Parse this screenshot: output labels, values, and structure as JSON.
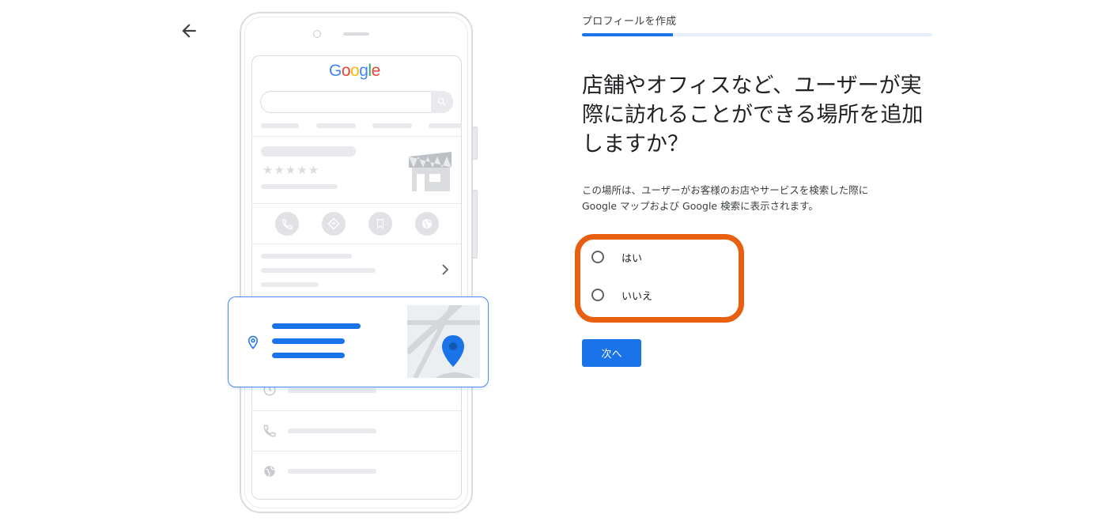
{
  "header": {
    "step_label": "プロフィールを作成",
    "progress": 0.26
  },
  "nav": {
    "back_icon": "arrow-back-icon"
  },
  "question": {
    "title": "店舗やオフィスなど、ユーザーが実際に訪れることができる場所を追加しますか？",
    "description_line1": "この場所は、ユーザーがお客様のお店やサービスを検索した際に",
    "description_line2": "Google マップおよび Google 検索に表示されます。"
  },
  "options": [
    {
      "label": "はい",
      "selected": false
    },
    {
      "label": "いいえ",
      "selected": false
    }
  ],
  "actions": {
    "next_label": "次へ"
  },
  "colors": {
    "accent": "#1a73e8",
    "highlight": "#e8600f"
  },
  "illustration": {
    "logo": [
      {
        "ch": "G",
        "color": "#4285f4"
      },
      {
        "ch": "o",
        "color": "#ea4335"
      },
      {
        "ch": "o",
        "color": "#fbbc05"
      },
      {
        "ch": "g",
        "color": "#4285f4"
      },
      {
        "ch": "l",
        "color": "#34a853"
      },
      {
        "ch": "e",
        "color": "#ea4335"
      }
    ],
    "stars": "★★★★★",
    "icons": [
      "search-icon",
      "phone-icon",
      "directions-icon",
      "bookmark-icon",
      "globe-icon",
      "location-pin-icon",
      "clock-icon",
      "storefront-icon"
    ]
  }
}
